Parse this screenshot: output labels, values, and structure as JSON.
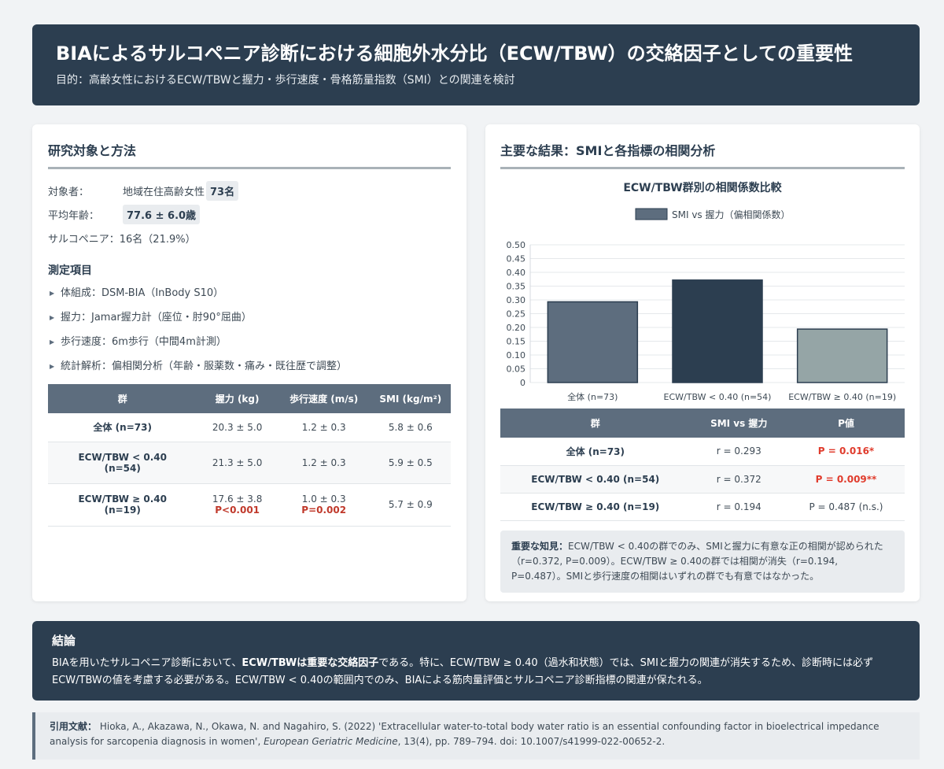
{
  "header": {
    "title": "BIAによるサルコペニア診断における細胞外水分比（ECW/TBW）の交絡因子としての重要性",
    "subtitle": "目的：高齢女性におけるECW/TBWと握力・歩行速度・骨格筋量指数（SMI）との関連を検討"
  },
  "methods": {
    "title": "研究対象と方法",
    "subjects_label": "対象者：",
    "subjects_value": "地域在住高齢女性",
    "subjects_count": "73名",
    "age_label": "平均年齢：",
    "age_value": "77.6 ± 6.0歳",
    "sarco_label": "サルコペニア：",
    "sarco_value": "16名（21.9%）",
    "measures_title": "測定項目",
    "measures": [
      "体組成：DSM-BIA（InBody S10）",
      "握力：Jamar握力計（座位・肘90°屈曲）",
      "歩行速度：6m歩行（中間4m計測）",
      "統計解析：偏相関分析（年齢・服薬数・痛み・既往歴で調整）"
    ],
    "table": {
      "headers": [
        "群",
        "握力 (kg)",
        "歩行速度 (m/s)",
        "SMI (kg/m²)"
      ],
      "rows": [
        {
          "group": "全体 (n=73)",
          "grip": "20.3 ± 5.0",
          "gait": "1.2 ± 0.3",
          "smi": "5.8 ± 0.6"
        },
        {
          "group_line1": "ECW/TBW < 0.40",
          "group_line2": "(n=54)",
          "grip": "21.3 ± 5.0",
          "gait": "1.2 ± 0.3",
          "smi": "5.9 ± 0.5"
        },
        {
          "group_line1": "ECW/TBW ≥ 0.40",
          "group_line2": "(n=19)",
          "grip": "17.6 ± 3.8",
          "grip_p": "P<0.001",
          "gait": "1.0 ± 0.3",
          "gait_p": "P=0.002",
          "smi": "5.7 ± 0.9"
        }
      ]
    }
  },
  "results": {
    "title": "主要な結果：SMIと各指標の相関分析",
    "chart_title": "ECW/TBW群別の相関係数比較",
    "table": {
      "headers": [
        "群",
        "SMI vs 握力",
        "P値"
      ],
      "rows": [
        {
          "group": "全体 (n=73)",
          "r": "r = 0.293",
          "p": "P = 0.016*"
        },
        {
          "group": "ECW/TBW < 0.40 (n=54)",
          "r": "r = 0.372",
          "p": "P = 0.009**"
        },
        {
          "group": "ECW/TBW ≥ 0.40 (n=19)",
          "r": "r = 0.194",
          "p": "P = 0.487 (n.s.)"
        }
      ]
    },
    "insight_label": "重要な知見：",
    "insight_text": "ECW/TBW < 0.40の群でのみ、SMIと握力に有意な正の相関が認められた（r=0.372, P=0.009）。ECW/TBW ≥ 0.40の群では相関が消失（r=0.194, P=0.487）。SMIと歩行速度の相関はいずれの群でも有意ではなかった。"
  },
  "chart_data": {
    "type": "bar",
    "title": "ECW/TBW群別の相関係数比較",
    "categories": [
      "全体 (n=73)",
      "ECW/TBW < 0.40 (n=54)",
      "ECW/TBW ≥ 0.40 (n=19)"
    ],
    "series": [
      {
        "name": "SMI vs 握力（偏相関係数）",
        "values": [
          0.293,
          0.372,
          0.194
        ]
      }
    ],
    "bar_colors": [
      "#5d6d7e",
      "#2c3e50",
      "#95a5a6"
    ],
    "ylim": [
      0,
      0.5
    ],
    "yticks": [
      "0",
      "0.05",
      "0.10",
      "0.15",
      "0.20",
      "0.25",
      "0.30",
      "0.35",
      "0.40",
      "0.45",
      "0.50"
    ],
    "xlabel": "",
    "ylabel": "",
    "grid": true,
    "legend_position": "top"
  },
  "conclusion": {
    "title": "結論",
    "text_1": "BIAを用いたサルコペニア診断において、",
    "text_bold": "ECW/TBWは重要な交絡因子",
    "text_2": "である。特に、ECW/TBW ≥ 0.40（過水和状態）では、SMIと握力の関連が消失するため、診断時には必ずECW/TBWの値を考慮する必要がある。ECW/TBW < 0.40の範囲内でのみ、BIAによる筋肉量評価とサルコペニア診断指標の関連が保たれる。"
  },
  "citation": {
    "label": "引用文献：",
    "text_1": "Hioka, A., Akazawa, N., Okawa, N. and Nagahiro, S. (2022) 'Extracellular water-to-total body water ratio is an essential confounding factor in bioelectrical impedance analysis for sarcopenia diagnosis in women', ",
    "journal": "European Geriatric Medicine",
    "text_2": ", 13(4), pp. 789–794. doi: 10.1007/s41999-022-00652-2."
  }
}
